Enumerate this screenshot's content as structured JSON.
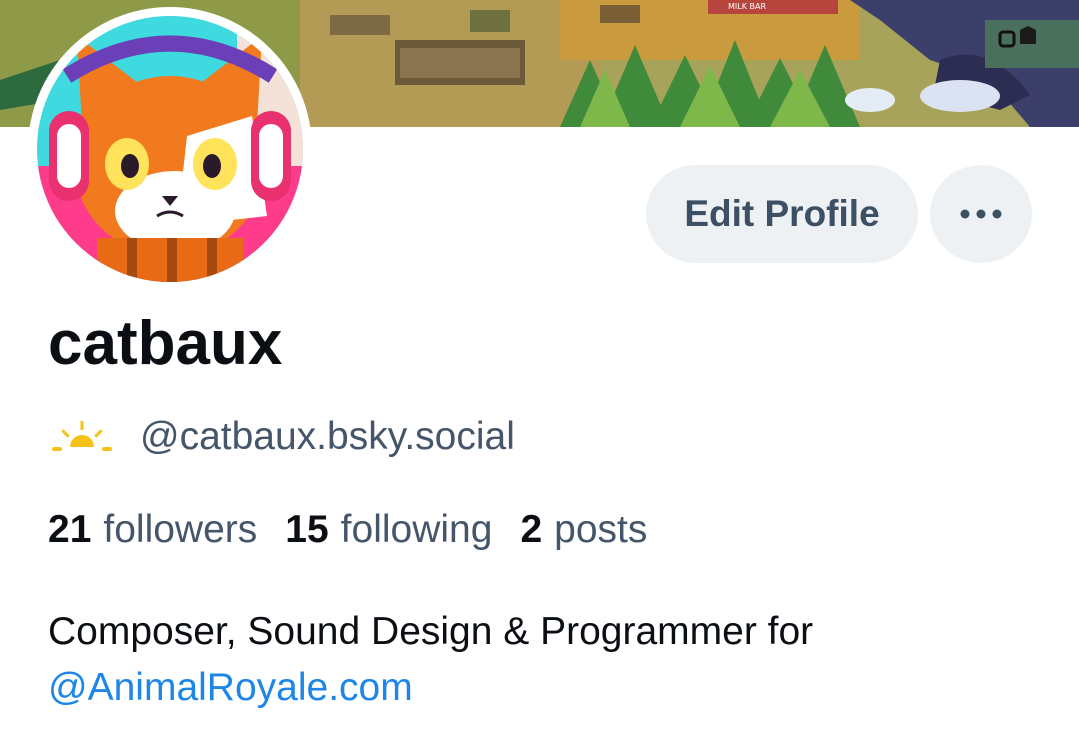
{
  "profile": {
    "display_name": "catbaux",
    "handle": "@catbaux.bsky.social",
    "edit_profile_label": "Edit Profile",
    "more_icon": "ellipsis-icon",
    "handle_icon": "sunrise-icon",
    "stats": {
      "followers_count": "21",
      "followers_label": "followers",
      "following_count": "15",
      "following_label": "following",
      "posts_count": "2",
      "posts_label": "posts"
    },
    "bio": {
      "line1": "Composer, Sound Design & Programmer for",
      "link": "@AnimalRoyale.com"
    }
  },
  "banner": {
    "sign_text": "MILK BAR"
  },
  "colors": {
    "accent_link": "#1e86e6",
    "button_bg": "#eef1f4",
    "muted_text": "#45566a",
    "sun_yellow": "#f6c21a"
  }
}
